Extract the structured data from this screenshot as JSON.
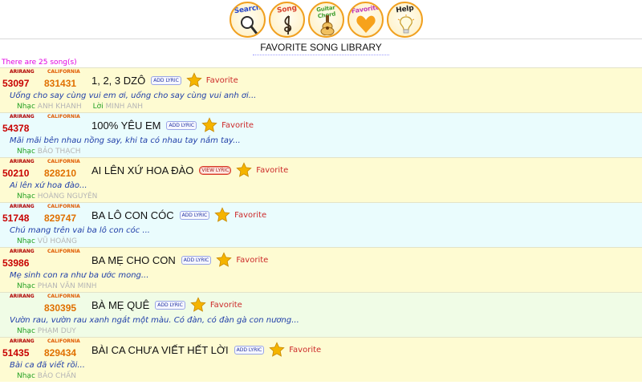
{
  "nav": {
    "search": {
      "label": "Search",
      "color": "#2747c9"
    },
    "song": {
      "label": "Song",
      "color": "#d8432f"
    },
    "guitar": {
      "label": "Guitar Chord",
      "color": "#3f9f2f"
    },
    "favorite": {
      "label": "Favorite",
      "color": "#c23ab6"
    },
    "help": {
      "label": "Help",
      "color": "#222222"
    }
  },
  "page_title": "FAVORITE SONG LIBRARY",
  "song_count_text": "There are 25 song(s)",
  "labels": {
    "arirang": "ARIRANG",
    "california": "CALIFORNIA",
    "favorite": "Favorite",
    "music": "Nhạc",
    "lyrics": "Lời"
  },
  "songs": [
    {
      "arirang": "53097",
      "california": "831431",
      "title": "1, 2, 3 DZÔ",
      "lyric_button": "ADD LYRIC",
      "preview": "Uống cho say cùng vui em ơi, uống cho say cùng vui anh ơi...",
      "composer": "ANH KHANH",
      "lyricist": "MINH ANH"
    },
    {
      "arirang": "54378",
      "california": "",
      "title": "100% YÊU EM",
      "lyric_button": "ADD LYRIC",
      "preview": "Mãi mãi bên nhau nồng say, khi ta có nhau tay nắm tay...",
      "composer": "BẢO THẠCH",
      "lyricist": ""
    },
    {
      "arirang": "50210",
      "california": "828210",
      "title": "AI LÊN XỨ HOA ĐÀO",
      "lyric_button": "VIEW LYRIC",
      "preview": "Ai lên xứ hoa đào...",
      "composer": "HOÀNG NGUYÊN",
      "lyricist": ""
    },
    {
      "arirang": "51748",
      "california": "829747",
      "title": "BA LÔ CON CÓC",
      "lyric_button": "ADD LYRIC",
      "preview": "Chú mang trên vai ba lô con cóc ...",
      "composer": "VŨ HOÀNG",
      "lyricist": ""
    },
    {
      "arirang": "53986",
      "california": "",
      "title": "BA MẸ CHO CON",
      "lyric_button": "ADD LYRIC",
      "preview": "Mẹ sinh con ra như ba ước mong...",
      "composer": "PHAN VĂN MINH",
      "lyricist": ""
    },
    {
      "arirang": "",
      "california": "830395",
      "title": "BÀ MẸ QUÊ",
      "lyric_button": "ADD LYRIC",
      "preview": "Vườn rau, vườn rau xanh ngắt một màu. Có đàn, có đàn gà con nương...",
      "composer": "PHẠM DUY",
      "lyricist": ""
    },
    {
      "arirang": "51435",
      "california": "829434",
      "title": "BÀI CA CHƯA VIẾT HẾT LỜI",
      "lyric_button": "ADD LYRIC",
      "preview": "Bài ca đã viết rồi...",
      "composer": "BẢO CHẤN",
      "lyricist": ""
    }
  ],
  "colors": {
    "row_yellow": "#fefbd2",
    "row_cyan": "#eafcfd",
    "row_green": "#f0fce6",
    "star": "#f5b400"
  }
}
